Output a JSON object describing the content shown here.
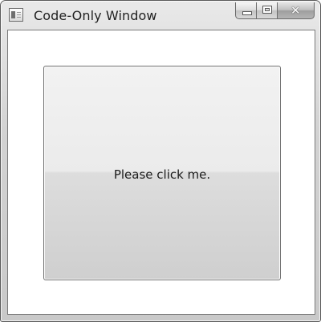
{
  "window": {
    "title": "Code-Only Window",
    "controls": {
      "minimize_icon": "minimize-icon",
      "maximize_icon": "maximize-icon",
      "close_icon": "close-icon",
      "close_glyph": "✕"
    }
  },
  "content": {
    "button_label": "Please click me."
  },
  "colors": {
    "frame_border": "#5a5a5a",
    "client_background": "#ffffff",
    "button_border": "#707070"
  }
}
